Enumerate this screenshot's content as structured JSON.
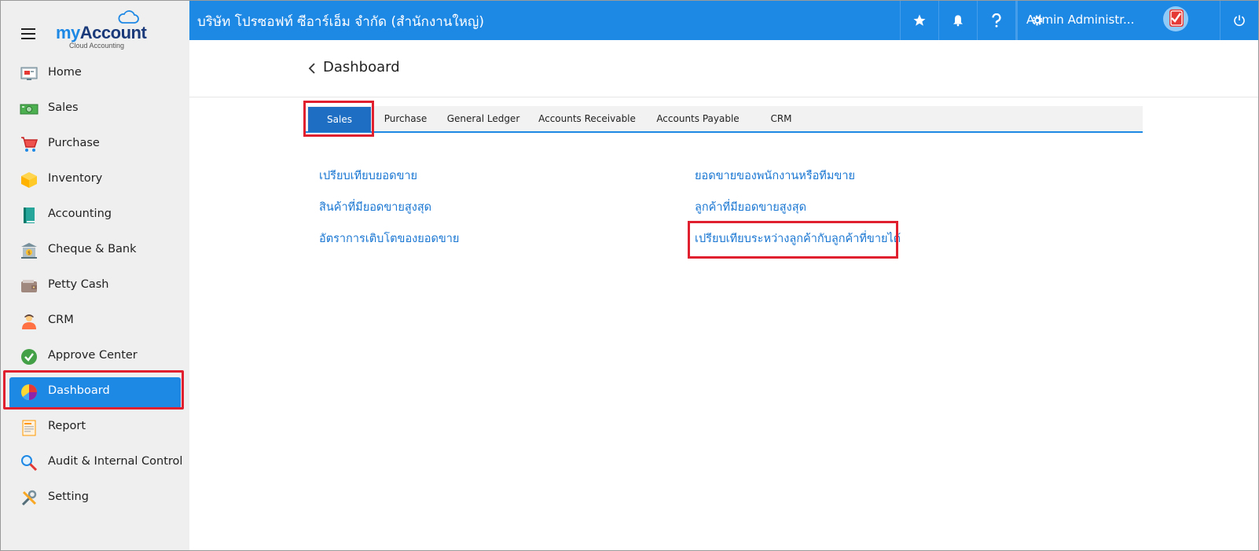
{
  "logo": {
    "my": "my",
    "account": "Account",
    "tagline": "Cloud Accounting"
  },
  "sidebar": {
    "items": [
      {
        "label": "Home",
        "icon": "home-icon"
      },
      {
        "label": "Sales",
        "icon": "sales-icon"
      },
      {
        "label": "Purchase",
        "icon": "cart-icon"
      },
      {
        "label": "Inventory",
        "icon": "box-icon"
      },
      {
        "label": "Accounting",
        "icon": "book-icon"
      },
      {
        "label": "Cheque & Bank",
        "icon": "bank-icon"
      },
      {
        "label": "Petty Cash",
        "icon": "wallet-icon"
      },
      {
        "label": "CRM",
        "icon": "people-icon"
      },
      {
        "label": "Approve Center",
        "icon": "check-circle-icon"
      },
      {
        "label": "Dashboard",
        "icon": "pie-chart-icon",
        "active": true
      },
      {
        "label": "Report",
        "icon": "report-icon"
      },
      {
        "label": "Audit & Internal Control",
        "icon": "magnifier-icon"
      },
      {
        "label": "Setting",
        "icon": "tools-icon"
      }
    ]
  },
  "topbar": {
    "company": "บริษัท โปรซอฟท์ ซีอาร์เอ็ม จำกัด (สำนักงานใหญ่)",
    "user": "Admin Administr...",
    "accent": "#1e88e5"
  },
  "page": {
    "title": "Dashboard"
  },
  "tabs": [
    {
      "label": "Sales",
      "active": true
    },
    {
      "label": "Purchase"
    },
    {
      "label": "General Ledger"
    },
    {
      "label": "Accounts Receivable"
    },
    {
      "label": "Accounts Payable"
    },
    {
      "label": "CRM"
    }
  ],
  "links": {
    "left": [
      "เปรียบเทียบยอดขาย",
      "สินค้าที่มียอดขายสูงสุด",
      "อัตราการเติบโตของยอดขาย"
    ],
    "right": [
      "ยอดขายของพนักงานหรือทีมขาย",
      "ลูกค้าที่มียอดขายสูงสุด",
      "เปรียบเทียบระหว่างลูกค้ากับลูกค้าที่ขายได้"
    ]
  }
}
